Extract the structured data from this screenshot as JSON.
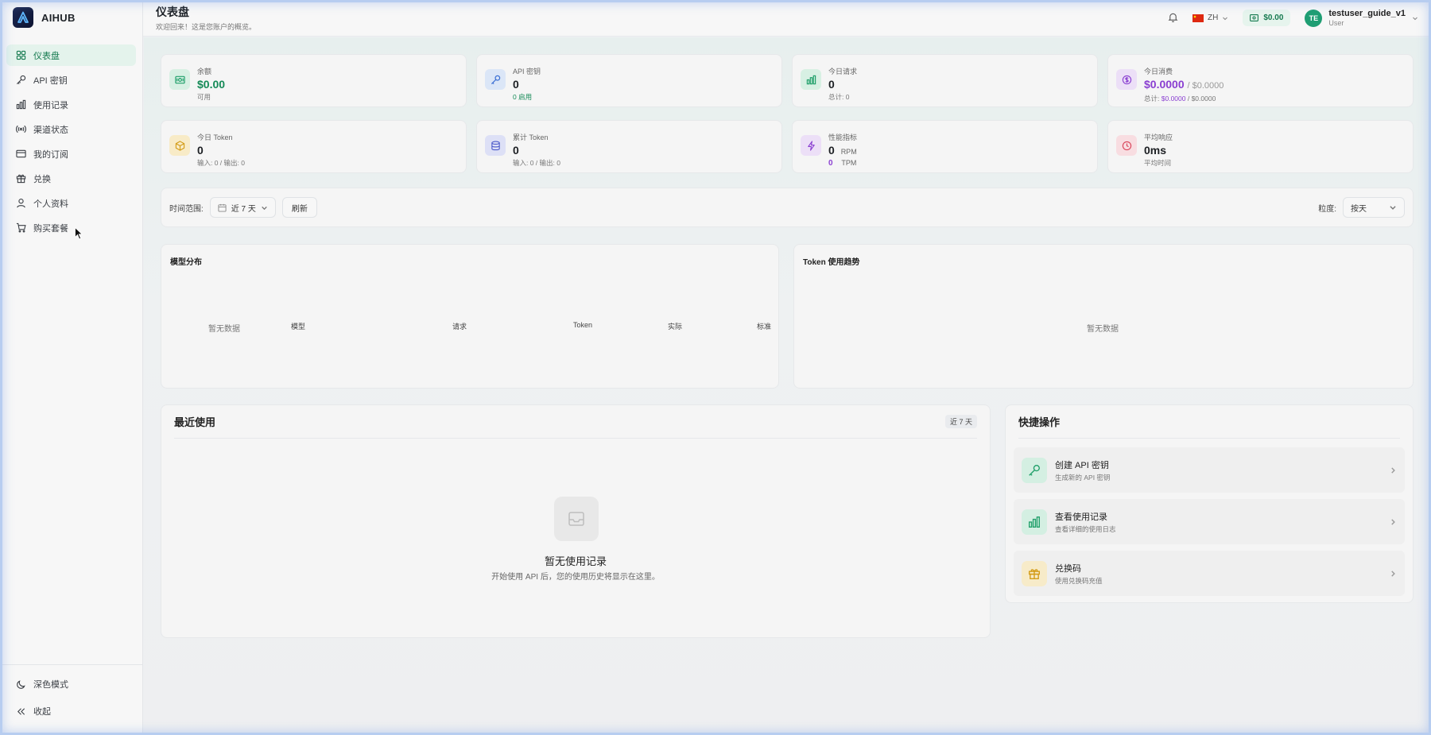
{
  "brand": {
    "name": "AIHUB"
  },
  "sidebar": {
    "items": [
      {
        "label": "仪表盘",
        "icon": "dashboard-icon",
        "active": true
      },
      {
        "label": "API 密钥",
        "icon": "key-icon"
      },
      {
        "label": "使用记录",
        "icon": "bar-chart-icon"
      },
      {
        "label": "渠道状态",
        "icon": "signal-icon"
      },
      {
        "label": "我的订阅",
        "icon": "credit-card-icon"
      },
      {
        "label": "兑换",
        "icon": "gift-icon"
      },
      {
        "label": "个人资料",
        "icon": "user-icon"
      },
      {
        "label": "购买套餐",
        "icon": "cart-icon"
      }
    ],
    "bottom": [
      {
        "label": "深色模式",
        "icon": "moon-icon"
      },
      {
        "label": "收起",
        "icon": "collapse-icon"
      }
    ]
  },
  "header": {
    "title": "仪表盘",
    "subtitle": "欢迎回来！这是您账户的概览。",
    "language": "ZH",
    "balance": "$0.00",
    "user": {
      "initials": "TE",
      "name": "testuser_guide_v1",
      "role": "User"
    }
  },
  "stats": [
    {
      "label": "余额",
      "value": "$0.00",
      "sub": "可用",
      "icon": "wallet-icon",
      "color": "#22a06b"
    },
    {
      "label": "API 密钥",
      "value": "0",
      "sub": "0 启用",
      "icon": "key-icon",
      "color": "#3b6fd4"
    },
    {
      "label": "今日请求",
      "value": "0",
      "sub": "总计: 0",
      "icon": "bar-chart-icon",
      "color": "#22a06b"
    },
    {
      "label": "今日消费",
      "value": "$0.0000",
      "value_extra": "/ $0.0000",
      "sub_prefix": "总计:",
      "sub_value": "$0.0000",
      "sub_suffix": "/ $0.0000",
      "icon": "dollar-icon",
      "color": "#8a3fd1"
    },
    {
      "label": "今日 Token",
      "value": "0",
      "sub": "输入: 0 / 输出: 0",
      "icon": "box-icon",
      "color": "#d39b16"
    },
    {
      "label": "累计 Token",
      "value": "0",
      "sub": "输入: 0 / 输出: 0",
      "icon": "database-icon",
      "color": "#4b59c9"
    },
    {
      "label": "性能指标",
      "value": "0",
      "value_unit": "RPM",
      "value2": "0",
      "value2_unit": "TPM",
      "icon": "lightning-icon",
      "color": "#8a3fd1"
    },
    {
      "label": "平均响应",
      "value": "0ms",
      "sub": "平均时间",
      "icon": "clock-icon",
      "color": "#d9445a"
    }
  ],
  "filters": {
    "time_range_label": "时间范围:",
    "time_range_value": "近 7 天",
    "refresh_label": "刷新",
    "granularity_label": "粒度:",
    "granularity_value": "按天"
  },
  "model_distribution": {
    "title": "模型分布",
    "empty": "暂无数据",
    "columns": [
      "模型",
      "请求",
      "Token",
      "实际",
      "标准"
    ]
  },
  "token_trend": {
    "title": "Token 使用趋势",
    "empty": "暂无数据"
  },
  "recent_usage": {
    "title": "最近使用",
    "badge": "近 7 天",
    "empty_title": "暂无使用记录",
    "empty_desc": "开始使用 API 后，您的使用历史将显示在这里。"
  },
  "quick_actions": {
    "title": "快捷操作",
    "items": [
      {
        "title": "创建 API 密钥",
        "sub": "生成新的 API 密钥",
        "icon": "key-icon",
        "color": "#22a06b"
      },
      {
        "title": "查看使用记录",
        "sub": "查看详细的使用日志",
        "icon": "bar-chart-icon",
        "color": "#22a06b"
      },
      {
        "title": "兑换码",
        "sub": "使用兑换码充值",
        "icon": "gift-icon",
        "color": "#d39b16"
      }
    ]
  }
}
